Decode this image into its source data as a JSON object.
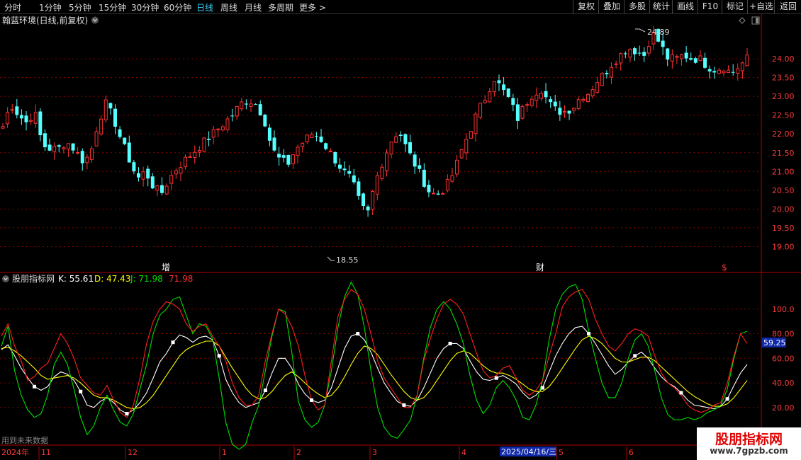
{
  "colors": {
    "up": "#ff3232",
    "down": "#54ffff",
    "grid": "#8a0000",
    "axis": "#b00000",
    "k": "#ffffff",
    "d": "#ffff00",
    "j": "#00e000",
    "extra": "#ff2020",
    "white": "#ffffff"
  },
  "topbar": {
    "periods": [
      "分时",
      "1分钟",
      "5分钟",
      "15分钟",
      "30分钟",
      "60分钟",
      "日线",
      "周线",
      "月线",
      "多周期",
      "更多 >"
    ],
    "active": "日线",
    "tools": [
      "复权",
      "叠加",
      "多股",
      "统计",
      "画线",
      "F10",
      "标记",
      "+自选",
      "返回"
    ]
  },
  "main": {
    "title": "翰蓝环境(日线,前复权)",
    "high_label": "24.89",
    "low_label": "18.55",
    "yticks": [
      "24.00",
      "23.50",
      "23.00",
      "22.50",
      "22.00",
      "21.50",
      "21.00",
      "20.50",
      "20.00",
      "19.50",
      "19.00"
    ],
    "events": [
      "增",
      "财",
      "$"
    ]
  },
  "indicator": {
    "name": "股朋指标网",
    "k_label": "K: 55.61",
    "d_label": "D: 47.43",
    "j_label": "J: 71.98",
    "extra_label": "71.98",
    "yticks": [
      "100.0",
      "80.00",
      "60.00",
      "40.00",
      "20.00"
    ],
    "current_value": "59.25",
    "note": "用到未来数据"
  },
  "timeline": {
    "labels": [
      "2024年",
      "11",
      "12",
      "1",
      "2",
      "3",
      "4",
      "2025/04/16/三",
      "5",
      "6"
    ]
  },
  "watermark": {
    "title": "股朋指标网",
    "url": "www.7gpzb.com"
  },
  "chart_data": [
    {
      "type": "candlestick",
      "title": "翰蓝环境(日线,前复权)",
      "ylim": [
        18.55,
        24.89
      ],
      "high": 24.89,
      "low": 18.55,
      "close_path": [
        22.2,
        22.8,
        22.5,
        22.3,
        22.6,
        21.7,
        21.6,
        21.6,
        21.8,
        21.6,
        21.3,
        21.4,
        22.3,
        22.8,
        22.4,
        21.8,
        21.3,
        20.8,
        21.0,
        20.6,
        20.4,
        20.8,
        21.1,
        21.3,
        21.5,
        21.7,
        21.9,
        22.1,
        22.3,
        22.5,
        22.8,
        22.9,
        22.8,
        22.4,
        21.6,
        21.3,
        21.2,
        21.6,
        21.8,
        22.0,
        21.9,
        21.6,
        21.3,
        21.0,
        20.8,
        20.2,
        19.8,
        20.7,
        21.3,
        21.8,
        22.1,
        21.6,
        21.2,
        20.8,
        20.4,
        20.4,
        20.6,
        21.0,
        21.6,
        22.1,
        22.6,
        23.0,
        23.5,
        23.2,
        22.9,
        22.4,
        22.8,
        23.1,
        23.2,
        22.8,
        22.6,
        22.6,
        22.7,
        23.0,
        23.1,
        23.4,
        23.6,
        23.9,
        24.1,
        24.3,
        24.2,
        24.1,
        24.7,
        24.4,
        24.0,
        24.0,
        24.1,
        24.0,
        24.0,
        23.8,
        23.7,
        23.8,
        23.6,
        23.8,
        24.0
      ]
    },
    {
      "type": "line",
      "title": "股朋指标网",
      "ylim": [
        0,
        120
      ],
      "series": [
        {
          "name": "K",
          "values": [
            67,
            71,
            62,
            52,
            44,
            37,
            34,
            37,
            45,
            49,
            47,
            42,
            33,
            22,
            20,
            25,
            28,
            24,
            18,
            15,
            18,
            24,
            32,
            44,
            57,
            64,
            73,
            79,
            77,
            73,
            77,
            78,
            75,
            62,
            43,
            32,
            24,
            20,
            22,
            24,
            34,
            48,
            60,
            60,
            52,
            39,
            31,
            26,
            24,
            26,
            36,
            52,
            68,
            78,
            80,
            75,
            65,
            52,
            40,
            32,
            25,
            22,
            21,
            26,
            36,
            48,
            60,
            68,
            72,
            72,
            68,
            58,
            49,
            43,
            42,
            44,
            46,
            43,
            39,
            32,
            27,
            30,
            36,
            49,
            62,
            72,
            80,
            85,
            86,
            80,
            72,
            63,
            54,
            47,
            51,
            57,
            62,
            65,
            60,
            52,
            45,
            40,
            37,
            32,
            26,
            22,
            21,
            20,
            19,
            21,
            27,
            38,
            48,
            55
          ]
        },
        {
          "name": "D",
          "values": [
            68,
            69,
            66,
            62,
            57,
            52,
            46,
            43,
            44,
            45,
            46,
            44,
            40,
            35,
            30,
            28,
            28,
            26,
            23,
            20,
            19,
            20,
            24,
            30,
            38,
            46,
            54,
            62,
            67,
            70,
            72,
            74,
            74,
            70,
            61,
            52,
            44,
            36,
            30,
            27,
            28,
            33,
            40,
            46,
            49,
            45,
            40,
            35,
            31,
            28,
            30,
            36,
            45,
            55,
            64,
            70,
            68,
            63,
            55,
            47,
            40,
            33,
            28,
            26,
            28,
            34,
            42,
            50,
            58,
            64,
            66,
            64,
            59,
            54,
            50,
            48,
            48,
            46,
            43,
            39,
            35,
            33,
            33,
            37,
            44,
            52,
            60,
            68,
            75,
            78,
            76,
            72,
            66,
            60,
            57,
            57,
            59,
            61,
            61,
            58,
            53,
            48,
            43,
            38,
            33,
            29,
            26,
            23,
            21,
            21,
            23,
            28,
            35,
            42
          ]
        },
        {
          "name": "J",
          "values": [
            70,
            86,
            50,
            30,
            18,
            12,
            15,
            30,
            55,
            65,
            55,
            35,
            12,
            -2,
            5,
            20,
            30,
            18,
            8,
            5,
            15,
            35,
            55,
            80,
            95,
            100,
            108,
            110,
            95,
            80,
            88,
            86,
            76,
            44,
            8,
            -10,
            -14,
            -10,
            8,
            22,
            50,
            78,
            100,
            98,
            65,
            25,
            10,
            4,
            8,
            22,
            50,
            85,
            110,
            122,
            112,
            85,
            50,
            20,
            4,
            -3,
            -5,
            2,
            10,
            30,
            60,
            85,
            100,
            106,
            100,
            88,
            72,
            46,
            26,
            15,
            22,
            36,
            42,
            36,
            26,
            12,
            10,
            22,
            42,
            75,
            100,
            112,
            118,
            120,
            108,
            82,
            60,
            40,
            28,
            28,
            40,
            60,
            75,
            80,
            70,
            50,
            28,
            14,
            10,
            10,
            12,
            10,
            12,
            16,
            18,
            22,
            35,
            60,
            80,
            82
          ]
        },
        {
          "name": "71.98",
          "values": [
            78,
            88,
            70,
            58,
            42,
            45,
            52,
            56,
            68,
            80,
            72,
            60,
            44,
            38,
            32,
            30,
            38,
            26,
            16,
            12,
            22,
            44,
            72,
            90,
            100,
            106,
            104,
            100,
            88,
            82,
            86,
            88,
            78,
            70,
            58,
            40,
            28,
            22,
            22,
            30,
            58,
            80,
            100,
            96,
            86,
            70,
            46,
            26,
            18,
            22,
            58,
            94,
            108,
            116,
            112,
            100,
            80,
            58,
            44,
            36,
            28,
            20,
            20,
            30,
            58,
            76,
            92,
            104,
            108,
            104,
            96,
            80,
            64,
            50,
            44,
            46,
            52,
            54,
            44,
            34,
            30,
            34,
            42,
            62,
            80,
            102,
            110,
            114,
            116,
            108,
            92,
            80,
            70,
            66,
            72,
            80,
            84,
            82,
            78,
            62,
            48,
            40,
            36,
            30,
            22,
            18,
            16,
            18,
            22,
            24,
            40,
            62,
            80,
            72
          ]
        }
      ]
    }
  ]
}
